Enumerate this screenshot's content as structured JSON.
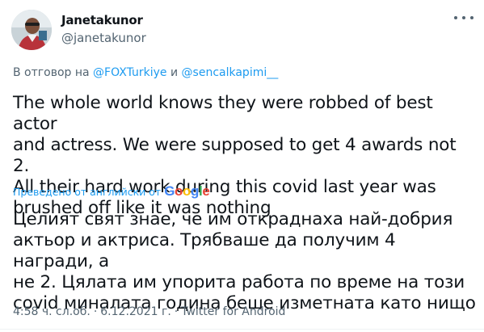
{
  "author": {
    "display_name": "Janetakunor",
    "handle": "@janetakunor"
  },
  "reply_context": {
    "prefix": "В отговор на",
    "mention_1": "@FOXTurkiye",
    "conjunction": "и",
    "mention_2": "@sencalkapimi__"
  },
  "tweet": {
    "text": "The whole world knows they were robbed of best actor\nand actress.  We were supposed to get 4 awards not 2.\nAll their hard work during this covid last year was\nbrushed off like it was nothing"
  },
  "translation": {
    "label": "Преведено от английски от",
    "provider_logo_text": "Google",
    "text": "Целият свят знае, че им откраднаха най-добрия\nактьор и актриса. Трябваше да получим 4 награди, а\nне 2. Цялата им упорита работа по време на този\ncovid миналата година беше изметната като нищо"
  },
  "meta": {
    "time": "4:58 ч. сл.об.",
    "separator": "·",
    "date": "6.12.2021 г.",
    "source": "Twitter for Android"
  },
  "icons": {
    "more": "more-horizontal-icon",
    "avatar": "profile-avatar"
  },
  "colors": {
    "link": "#1d9bf0",
    "text": "#0f1419",
    "secondary": "#536471",
    "google_blue": "#4285F4",
    "google_red": "#EA4335",
    "google_yellow": "#FBBC05",
    "google_green": "#34A853"
  }
}
